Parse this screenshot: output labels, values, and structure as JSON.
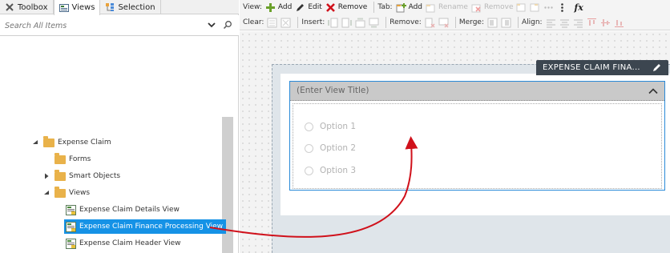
{
  "left_panel": {
    "tabs": [
      {
        "label": "Toolbox",
        "icon": "wrench-cross-icon"
      },
      {
        "label": "Views",
        "icon": "views-icon",
        "active": true
      },
      {
        "label": "Selection",
        "icon": "selection-icon"
      }
    ],
    "search": {
      "placeholder": "Search All Items"
    },
    "tree": {
      "root": "Expense Claim",
      "forms": "Forms",
      "smart_objects": "Smart Objects",
      "views": "Views",
      "items": [
        "Expense Claim Details View",
        "Expense Claim Finance Processing View",
        "Expense Claim Header View"
      ]
    }
  },
  "toolbar": {
    "view_label": "View:",
    "add": "Add",
    "edit": "Edit",
    "remove": "Remove",
    "tab_label": "Tab:",
    "tab_add": "Add",
    "tab_rename": "Rename",
    "tab_remove": "Remove",
    "fx": "fx",
    "clear_label": "Clear:",
    "insert_label": "Insert:",
    "remove_label": "Remove:",
    "merge_label": "Merge:",
    "align_label": "Align:"
  },
  "canvas": {
    "form_tag": "EXPENSE CLAIM FINA...",
    "view_title_placeholder": "(Enter View Title)",
    "options": [
      "Option 1",
      "Option 2",
      "Option 3"
    ]
  },
  "colors": {
    "selection": "#1592e6",
    "drag_arrow": "#d0111b",
    "tag_bg": "#3c4650",
    "view_border": "#2a8ad8"
  }
}
